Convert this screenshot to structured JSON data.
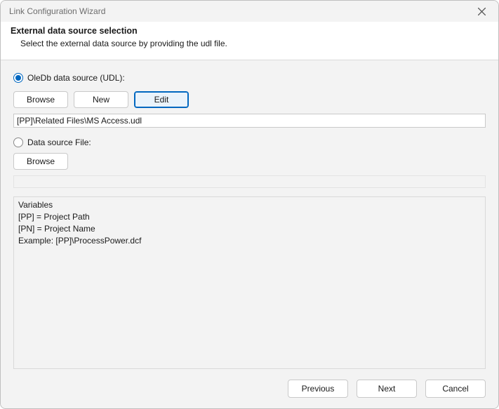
{
  "window": {
    "title": "Link Configuration Wizard"
  },
  "header": {
    "heading": "External data source selection",
    "subtext": "Select the external data source by providing the udl file."
  },
  "oledb": {
    "radio_label": "OleDb data source (UDL):",
    "browse": "Browse",
    "new": "New",
    "edit": "Edit",
    "path_value": "[PP]\\Related Files\\MS Access.udl"
  },
  "filesrc": {
    "radio_label": "Data source File:",
    "browse": "Browse",
    "path_value": ""
  },
  "variables": {
    "heading": "Variables",
    "lines": [
      "[PP] =   Project Path",
      "[PN] =   Project Name",
      "Example: [PP]\\ProcessPower.dcf"
    ]
  },
  "footer": {
    "previous": "Previous",
    "next": "Next",
    "cancel": "Cancel"
  }
}
